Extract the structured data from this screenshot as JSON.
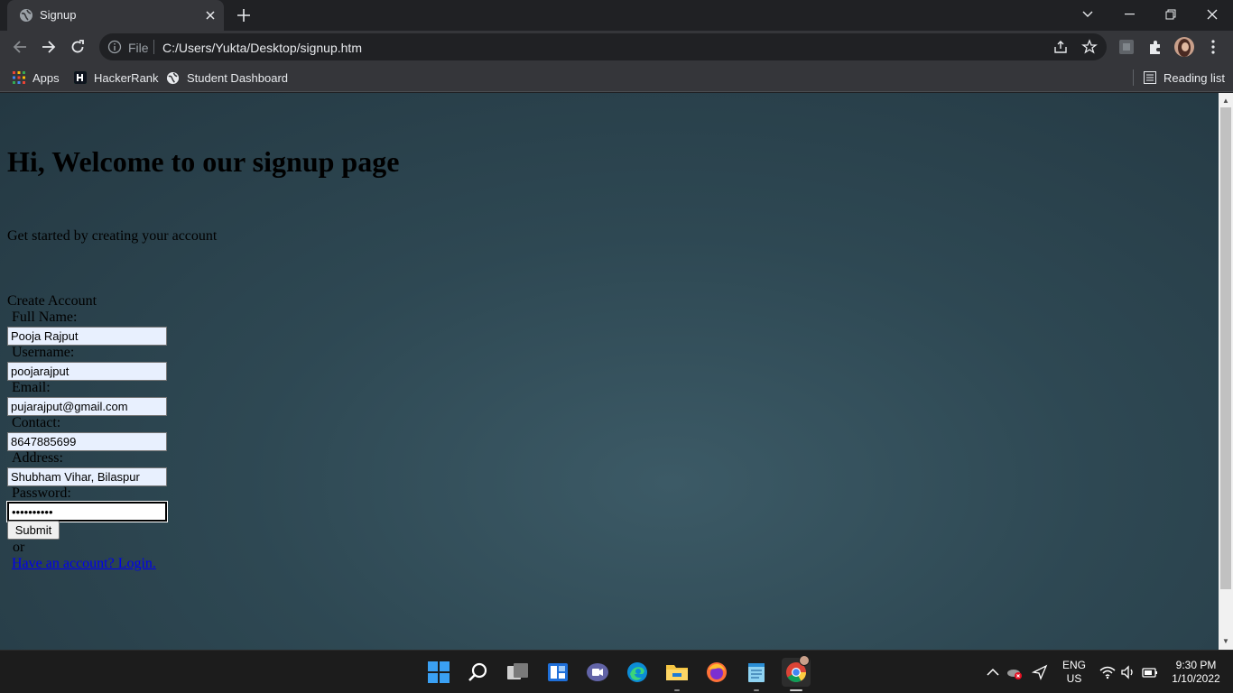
{
  "browser": {
    "tab_title": "Signup",
    "omnibox_scheme": "File",
    "url": "C:/Users/Yukta/Desktop/signup.htm",
    "bookmarks": [
      "Apps",
      "HackerRank",
      "Student Dashboard"
    ],
    "reading_list": "Reading list"
  },
  "page": {
    "heading": "Hi, Welcome to our signup page",
    "subheading": "Get started by creating your account",
    "form_legend": "Create Account",
    "fields": [
      {
        "label": "Full Name:",
        "value": "Pooja Rajput"
      },
      {
        "label": "Username:",
        "value": "poojarajput"
      },
      {
        "label": "Email:",
        "value": "pujarajput@gmail.com"
      },
      {
        "label": "Contact:",
        "value": "8647885699"
      },
      {
        "label": "Address:",
        "value": "Shubham Vihar, Bilaspur"
      },
      {
        "label": "Password:",
        "value": "••••••••••"
      }
    ],
    "submit_label": "Submit",
    "or_text": "or",
    "login_link": "Have an account? Login."
  },
  "taskbar": {
    "language_top": "ENG",
    "language_bottom": "US",
    "time": "9:30 PM",
    "date": "1/10/2022"
  },
  "colors": {
    "browser_frame": "#202124",
    "toolbar": "#35363a",
    "page_bg": "#2e4853",
    "link": "#0000ee",
    "autofill_bg": "#e8f0fe"
  }
}
